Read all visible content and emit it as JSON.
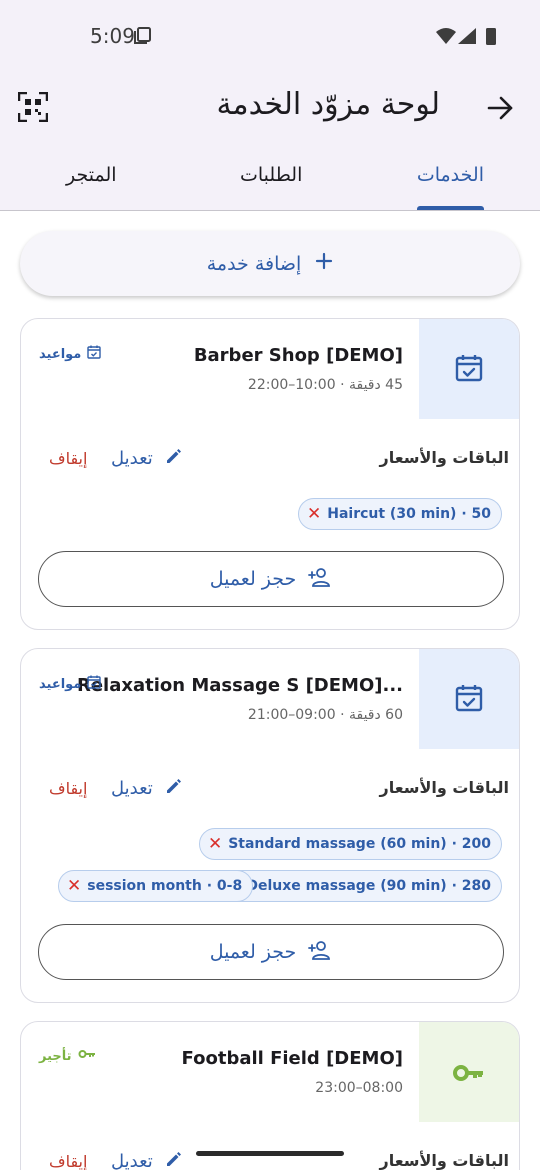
{
  "status_bar": {
    "time": "5:09"
  },
  "header": {
    "title": "لوحة مزوّد الخدمة"
  },
  "tabs": [
    {
      "label": "الخدمات",
      "active": true
    },
    {
      "label": "الطلبات",
      "active": false
    },
    {
      "label": "المتجر",
      "active": false
    }
  ],
  "add_service": {
    "label": "إضافة خدمة"
  },
  "cards": [
    {
      "title": "Barber Shop [DEMO]",
      "subtitle": "45 دقيقة · 10:00–22:00",
      "type_label": "مواعيد",
      "type_icon": "calendar-check-icon",
      "packages_label": "الباقات والأسعار",
      "edit_label": "تعديل",
      "stop_label": "إيقاف",
      "chips": [
        "Haircut (30 min) · 50"
      ],
      "book_label": "حجز لعميل",
      "accent": "#2f5da8",
      "icon_bg": "#e6eefc"
    },
    {
      "title": "Relaxation Massage S [DEMO]...",
      "subtitle": "60 دقيقة · 09:00–21:00",
      "type_label": "مواعيد",
      "type_icon": "calendar-check-icon",
      "packages_label": "الباقات والأسعار",
      "edit_label": "تعديل",
      "stop_label": "إيقاف",
      "chips": [
        "Standard massage (60 min) · 200",
        "Deluxe massage (90 min) · 280",
        "session month · 0-8"
      ],
      "book_label": "حجز لعميل",
      "accent": "#2f5da8",
      "icon_bg": "#e6eefc"
    },
    {
      "title": "Football Field [DEMO]",
      "subtitle": "08:00–23:00",
      "type_label": "تأجير",
      "type_icon": "key-icon",
      "packages_label": "الباقات والأسعار",
      "edit_label": "تعديل",
      "stop_label": "إيقاف",
      "accent": "#7cb342",
      "icon_bg": "#eef6e6"
    }
  ]
}
